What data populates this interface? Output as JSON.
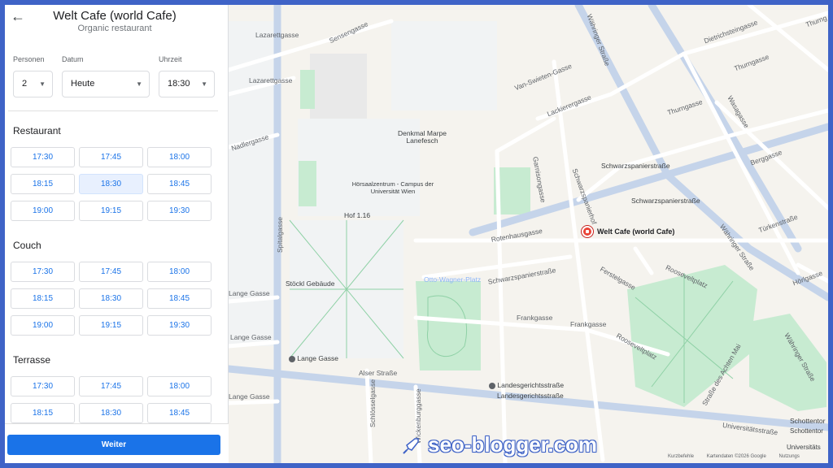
{
  "header": {
    "title": "Welt Cafe (world Cafe)",
    "subtitle": "Organic restaurant"
  },
  "form": {
    "persons_label": "Personen",
    "persons_value": "2",
    "date_label": "Datum",
    "date_value": "Heute",
    "time_label": "Uhrzeit",
    "time_value": "18:30"
  },
  "sections": [
    {
      "name": "Restaurant",
      "slots": [
        "17:30",
        "17:45",
        "18:00",
        "18:15",
        "18:30",
        "18:45",
        "19:00",
        "19:15",
        "19:30"
      ]
    },
    {
      "name": "Couch",
      "slots": [
        "17:30",
        "17:45",
        "18:00",
        "18:15",
        "18:30",
        "18:45",
        "19:00",
        "19:15",
        "19:30"
      ]
    },
    {
      "name": "Terrasse",
      "slots": [
        "17:30",
        "17:45",
        "18:00",
        "18:15",
        "18:30",
        "18:45"
      ]
    }
  ],
  "selected_slot": {
    "section": "Restaurant",
    "time": "18:30"
  },
  "footer": {
    "button": "Weiter"
  },
  "map": {
    "labels": {
      "lazarettgasse1": "Lazarettgasse",
      "lazarettgasse2": "Lazarettgasse",
      "sensengasse": "Sensengasse",
      "spitalgasse": "Spitalgasse",
      "nadlergasse": "Nadlergasse",
      "denkmal": "Denkmal Marpe Lanefesch",
      "hoersaal": "Hörsaalzentrum - Campus der Universität Wien",
      "hof": "Hof 1.16",
      "stoeckl": "Stöckl Gebäude",
      "lange_gasse1": "Lange Gasse",
      "lange_gasse2": "Lange Gasse",
      "lange_gasse3": "Lange Gasse",
      "lange_gasse4": "Lange Gasse",
      "alser": "Alser Straße",
      "schlossel": "Schlösselgasse",
      "wickenburg": "Wickenburggasse",
      "landes1": "Landesgerichtsstraße",
      "landes2": "Landesgerichtsstraße",
      "otto": "Otto-Wagner-Platz",
      "schwarzsp1": "Schwarzspanierstraße",
      "schwarzsp2": "Schwarzspanierstraße",
      "schwarzsp3": "Schwarzspanierstraße",
      "schwarzsphof": "Schwarzspanierhof",
      "rotenhaus": "Rotenhausgasse",
      "garnison": "Garnisongasse",
      "vanswieten": "Van-Swieten-Gasse",
      "lackierer": "Lackierergasse",
      "waehringer1": "Währinger Straße",
      "waehringer2": "Währinger Straße",
      "waehringer3": "Währinger Straße",
      "thurngasse1": "Thurngasse",
      "thurngasse2": "Thurngasse",
      "thurngasse3": "Thurng",
      "dietrichstein": "Dietrichsteingasse",
      "wasagasse": "Wasagasse",
      "berggasse": "Berggasse",
      "tuerken": "Türkenstraße",
      "hoerlgasse": "Hörlgasse",
      "ferstel": "Ferstelgasse",
      "roosevelt1": "Rooseveltplatz",
      "roosevelt2": "Rooseveltplatz",
      "frankgasse1": "Frankgasse",
      "frankgasse2": "Frankgasse",
      "achtenmai": "Straße des Achten Mai",
      "universitaet": "Universitätsstraße",
      "schottentor1": "Schottentor",
      "schottentor2": "Schottentor",
      "universitae2": "Universitäts",
      "poi": "Welt Cafe (world Cafe)"
    },
    "credits": {
      "keys": "Kurzbefehle",
      "data": "Kartendaten ©2026 Google",
      "terms": "Nutzungs"
    }
  },
  "watermark": {
    "text": "seo-blogger.com"
  },
  "colors": {
    "accent": "#1a73e8",
    "frame": "#3f63c7",
    "park": "#c7ebd1",
    "road": "#ffffff",
    "major_road": "#c5d4ea"
  }
}
